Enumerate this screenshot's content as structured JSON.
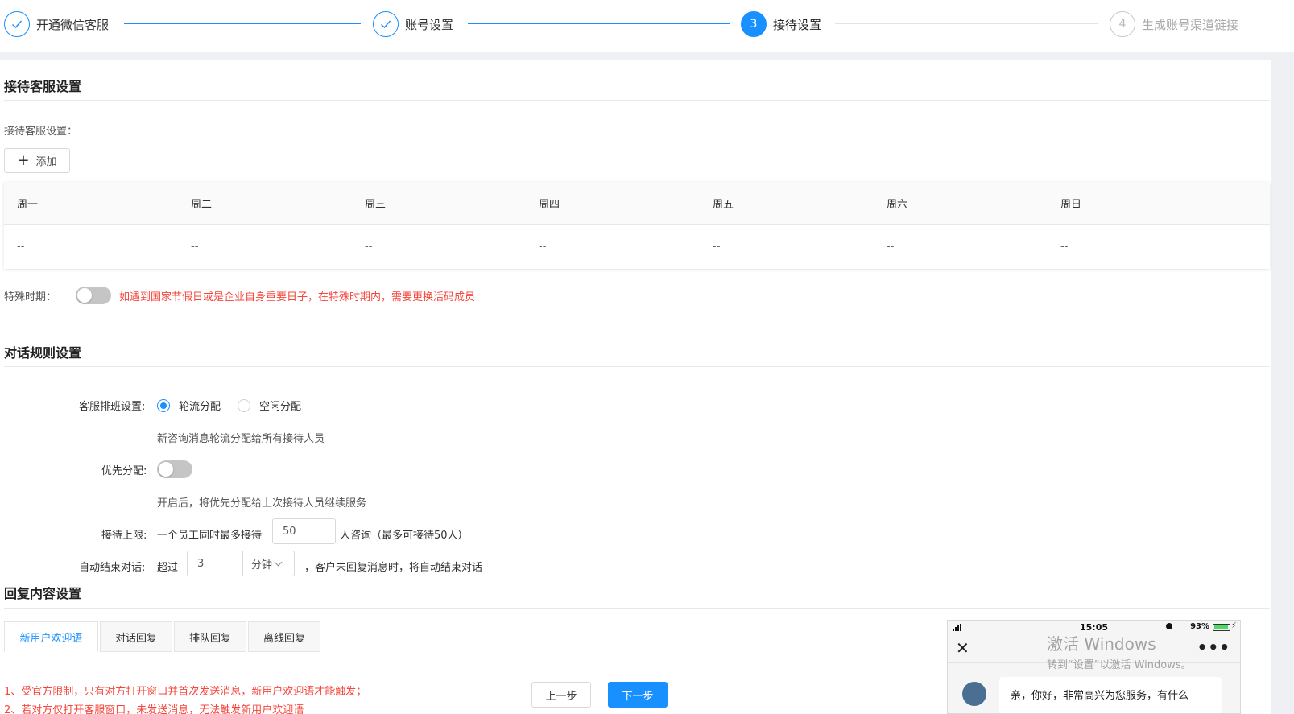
{
  "steps": [
    {
      "label": "开通微信客服",
      "status": "done",
      "num": ""
    },
    {
      "label": "账号设置",
      "status": "done",
      "num": ""
    },
    {
      "label": "接待设置",
      "status": "active",
      "num": "3"
    },
    {
      "label": "生成账号渠道链接",
      "status": "wait",
      "num": "4"
    }
  ],
  "reception": {
    "title": "接待客服设置",
    "field_label": "接待客服设置：",
    "add_button": "添加",
    "weekdays": [
      "周一",
      "周二",
      "周三",
      "周四",
      "周五",
      "周六",
      "周日"
    ],
    "values": [
      "--",
      "--",
      "--",
      "--",
      "--",
      "--",
      "--"
    ],
    "special_label": "特殊时期：",
    "special_enabled": false,
    "special_hint": "如遇到国家节假日或是企业自身重要日子，在特殊时期内，需要更换活码成员"
  },
  "dialog_rules": {
    "title": "对话规则设置",
    "schedule_label": "客服排班设置:",
    "schedule_options": [
      "轮流分配",
      "空闲分配"
    ],
    "schedule_selected": "轮流分配",
    "schedule_hint": "新咨询消息轮流分配给所有接待人员",
    "priority_label": "优先分配:",
    "priority_enabled": false,
    "priority_hint": "开启后，将优先分配给上次接待人员继续服务",
    "limit_label": "接待上限:",
    "limit_prefix": "一个员工同时最多接待",
    "limit_value": "50",
    "limit_suffix": "人咨询（最多可接待50人）",
    "auto_end_label": "自动结束对话:",
    "auto_end_prefix": "超过",
    "auto_end_value": "3",
    "auto_end_unit": "分钟",
    "auto_end_suffix": "，客户未回复消息时，将自动结束对话"
  },
  "reply": {
    "title": "回复内容设置",
    "tabs": [
      "新用户欢迎语",
      "对话回复",
      "排队回复",
      "离线回复"
    ],
    "active_tab": "新用户欢迎语",
    "warnings": [
      "1、受官方限制，只有对方打开窗口并首次发送消息，新用户欢迎语才能触发；",
      "2、若对方仅打开客服窗口，未发送消息，无法触发新用户欢迎语"
    ]
  },
  "buttons": {
    "prev": "上一步",
    "next": "下一步"
  },
  "phone": {
    "time": "15:05",
    "battery": "93%",
    "message": "亲，你好，非常高兴为您服务，有什么"
  },
  "watermark": {
    "line1": "激活 Windows",
    "line2": "转到“设置”以激活 Windows。"
  },
  "colors": {
    "primary": "#1890ff",
    "warning": "#f5463b",
    "band": "#eef0f4"
  }
}
